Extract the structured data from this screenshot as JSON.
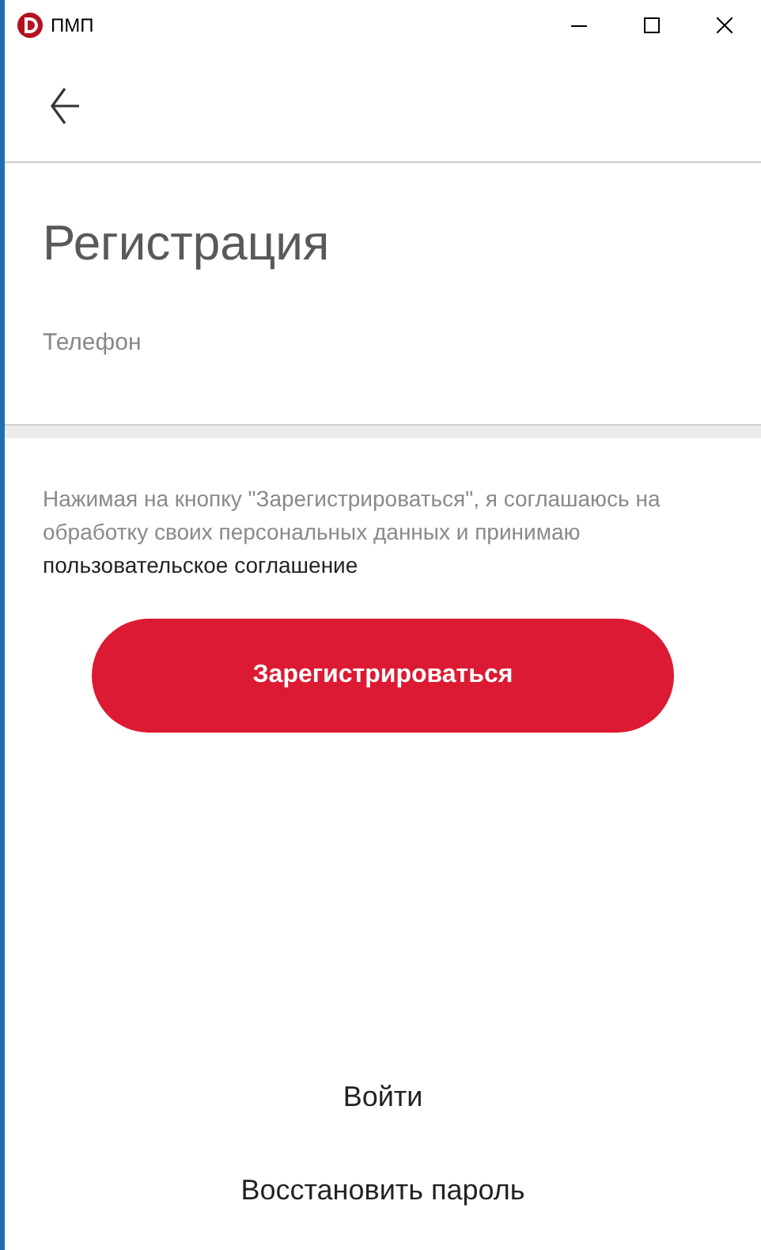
{
  "window": {
    "title": "ПМП"
  },
  "page": {
    "title": "Регистрация"
  },
  "phone_field": {
    "placeholder": "Телефон"
  },
  "consent": {
    "text": "Нажимая на кнопку \"Зарегистрироваться\", я соглашаюсь на обработку своих персональных данных и принимаю",
    "link": "пользовательское соглашение"
  },
  "register_button": "Зарегистрироваться",
  "links": [
    "Войти",
    "Восстановить пароль"
  ]
}
